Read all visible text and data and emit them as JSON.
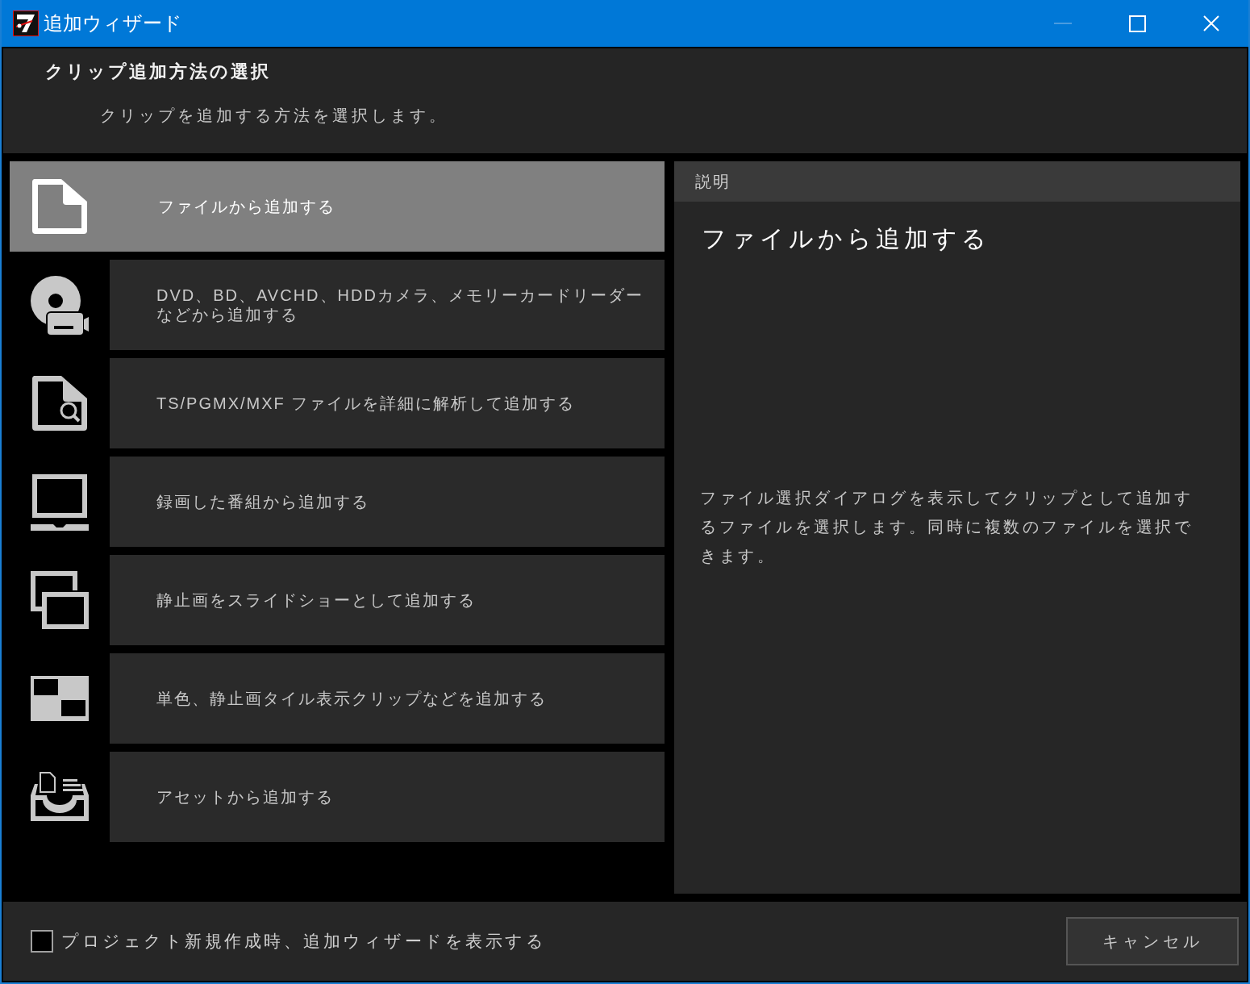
{
  "window": {
    "title": "追加ウィザード",
    "minimize_disabled": true
  },
  "header": {
    "title": "クリップ追加方法の選択",
    "subtitle": "クリップを追加する方法を選択します。"
  },
  "methods": [
    {
      "kind": "file",
      "lines": [
        "ファイルから追加する"
      ],
      "selected": true
    },
    {
      "kind": "disc-camera",
      "lines": [
        "DVD、BD、AVCHD、HDDカメラ、メモリーカードリーダー",
        "などから追加する"
      ],
      "selected": false
    },
    {
      "kind": "file-search",
      "lines": [
        "TS/PGMX/MXF ファイルを詳細に解析して追加する"
      ],
      "selected": false
    },
    {
      "kind": "laptop",
      "lines": [
        "録画した番組から追加する"
      ],
      "selected": false
    },
    {
      "kind": "slideshow",
      "lines": [
        "静止画をスライドショーとして追加する"
      ],
      "selected": false
    },
    {
      "kind": "tiles",
      "lines": [
        "単色、静止画タイル表示クリップなどを追加する"
      ],
      "selected": false
    },
    {
      "kind": "asset",
      "lines": [
        "アセットから追加する"
      ],
      "selected": false
    }
  ],
  "description": {
    "heading": "説明",
    "title": "ファイルから追加する",
    "body": "ファイル選択ダイアログを表示してクリップとして追加するファイルを選択します。同時に複数のファイルを選択できます。"
  },
  "footer": {
    "checkbox": {
      "label": "プロジェクト新規作成時、追加ウィザードを表示する",
      "checked": false
    },
    "cancel": "キャンセル"
  }
}
